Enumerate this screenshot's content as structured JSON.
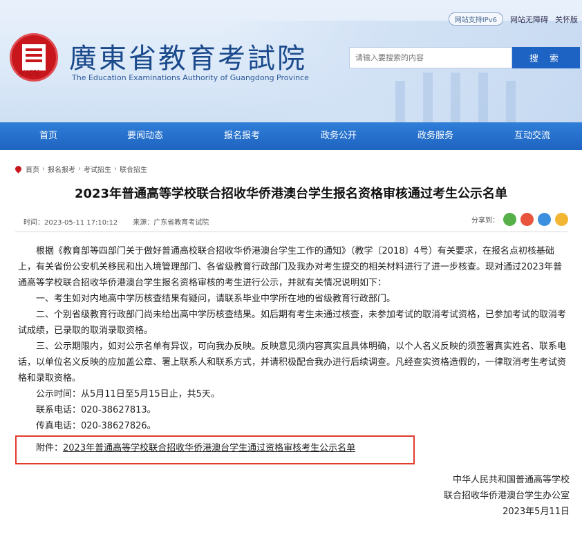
{
  "header": {
    "ipv6_badge": "网站支持IPv6",
    "accessibility_link": "网站无障碍",
    "elder_mode_link": "关怀版",
    "logo_script": "考试院",
    "site_title": "廣東省教育考試院",
    "site_subtitle": "The Education Examinations Authority of Guangdong Province",
    "search_placeholder": "请输入要搜索的内容",
    "search_button": "搜 索"
  },
  "nav": {
    "items": [
      {
        "label": "首页"
      },
      {
        "label": "要闻动态"
      },
      {
        "label": "报名报考"
      },
      {
        "label": "政务公开"
      },
      {
        "label": "政务服务"
      },
      {
        "label": "互动交流"
      }
    ]
  },
  "breadcrumb": [
    "首页",
    "报名报考",
    "考试招生",
    "联合招生"
  ],
  "article": {
    "title": "2023年普通高等学校联合招收华侨港澳台学生报名资格审核通过考生公示名单",
    "time": "时间：2023-05-11 17:10:12",
    "source": "来源：广东省教育考试院",
    "share_label": "分享到：",
    "paragraphs": [
      "根据《教育部等四部门关于做好普通高校联合招收华侨港澳台学生工作的通知》（教学〔2018〕4号）有关要求，在报名点初核基础上，有关省份公安机关移民和出入境管理部门、各省级教育行政部门及我办对考生提交的相关材料进行了进一步核查。现对通过2023年普通高等学校联合招收华侨港澳台学生报名资格审核的考生进行公示，并就有关情况说明如下：",
      "一、考生如对内地高中学历核查结果有疑问，请联系毕业中学所在地的省级教育行政部门。",
      "二、个别省级教育行政部门尚未给出高中学历核查结果。如后期有考生未通过核查，未参加考试的取消考试资格，已参加考试的取消考试成绩，已录取的取消录取资格。",
      "三、公示期限内，如对公示名单有异议，可向我办反映。反映意见须内容真实且具体明确，以个人名义反映的须签署真实姓名、联系电话，以单位名义反映的应加盖公章、署上联系人和联系方式，并请积极配合我办进行后续调查。凡经查实资格造假的，一律取消考生考试资格和录取资格。",
      "公示时间：从5月11日至5月15日止，共5天。",
      "联系电话：020-38627813。",
      "传真电话：020-38627826。"
    ],
    "attachment_prefix": "附件：",
    "attachment_link": "2023年普通高等学校联合招收华侨港澳台学生通过资格审核考生公示名单",
    "signature": [
      "中华人民共和国普通高等学校",
      "联合招收华侨港澳台学生办公室",
      "2023年5月11日"
    ]
  },
  "colors": {
    "nav_blue": "#1e64c0",
    "title_blue": "#1a4a8c",
    "logo_red": "#c8161d",
    "highlight_red": "#e23b2e"
  }
}
